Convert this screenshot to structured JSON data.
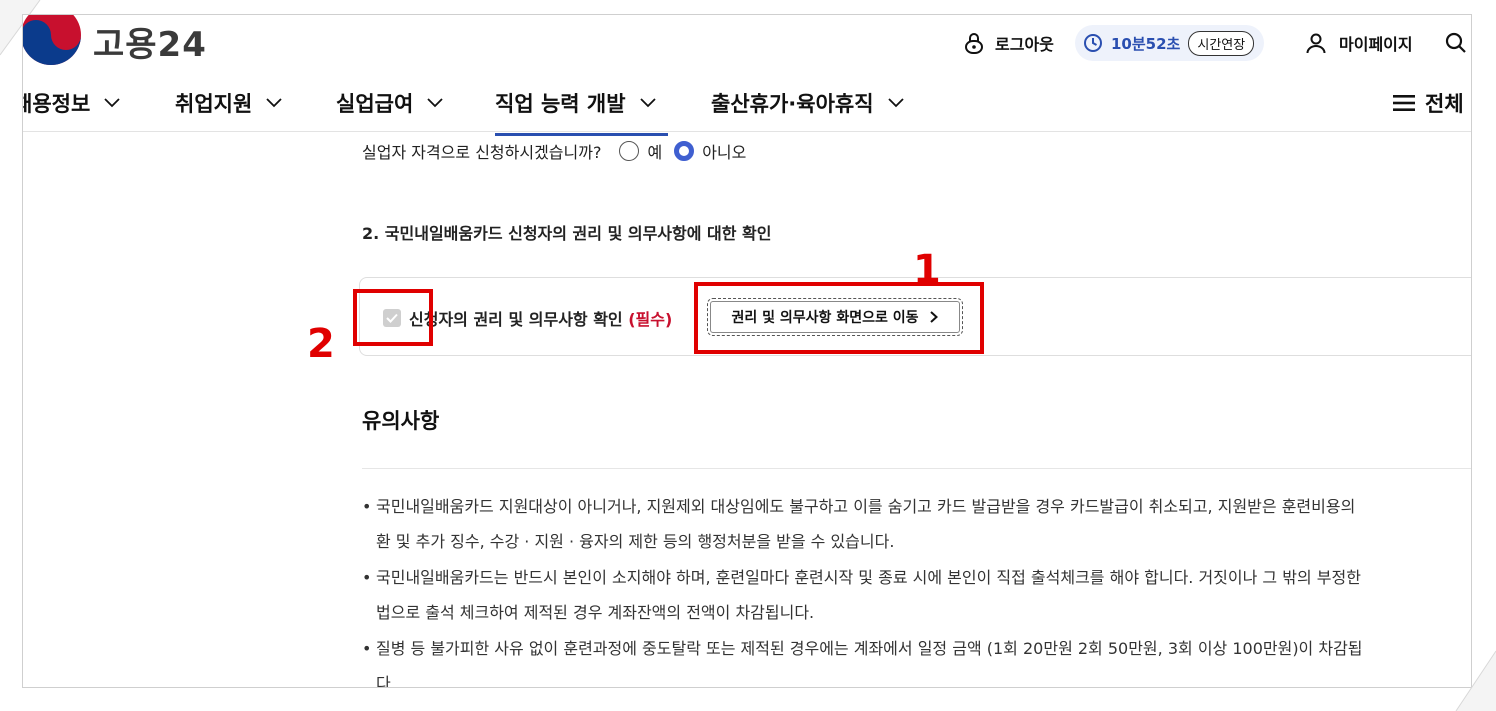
{
  "header": {
    "logo_text": "고용24",
    "logout_label": "로그아웃",
    "timer": "10분52초",
    "extend_label": "시간연장",
    "mypage_label": "마이페이지"
  },
  "nav": {
    "items": [
      "채용정보",
      "취업지원",
      "실업급여",
      "직업 능력 개발",
      "출산휴가·육아휴직"
    ],
    "active_index": 3,
    "all_label": "전체"
  },
  "form": {
    "question": "실업자 자격으로 신청하시겠습니까?",
    "options": [
      "예",
      "아니오"
    ],
    "selected": "아니오",
    "section2_title": "2. 국민내일배움카드 신청자의 권리 및 의무사항에 대한 확인",
    "confirm_label": "신청자의 권리 및 의무사항 확인",
    "required_tag": "(필수)",
    "confirm_checked": true,
    "goto_button": "권리 및 의무사항 화면으로 이동"
  },
  "annotations": {
    "box1_number": "1",
    "box2_number": "2",
    "color": "#e00000"
  },
  "notes": {
    "title": "유의사항",
    "items": [
      {
        "line1": "국민내일배움카드 지원대상이 아니거나, 지원제외 대상임에도 불구하고 이를 숨기고 카드 발급받을 경우 카드발급이 취소되고, 지원받은 훈련비용의",
        "line2": "환 및 추가 징수, 수강 · 지원 · 융자의 제한 등의 행정처분을 받을 수 있습니다."
      },
      {
        "line1": "국민내일배움카드는 반드시 본인이 소지해야 하며, 훈련일마다 훈련시작 및 종료 시에 본인이 직접 출석체크를 해야 합니다. 거짓이나 그 밖의 부정한",
        "line2": "법으로 출석 체크하여 제적된 경우 계좌잔액의 전액이 차감됩니다."
      },
      {
        "line1": "질병 등 불가피한 사유 없이 훈련과정에 중도탈락 또는 제적된 경우에는 계좌에서 일정 금액 (1회 20만원 2회 50만원, 3회 이상 100만원)이 차감됩",
        "line2": "다."
      }
    ]
  },
  "colors": {
    "accent": "#2a4fb0",
    "required": "#c8102e",
    "annotation": "#e00000"
  }
}
